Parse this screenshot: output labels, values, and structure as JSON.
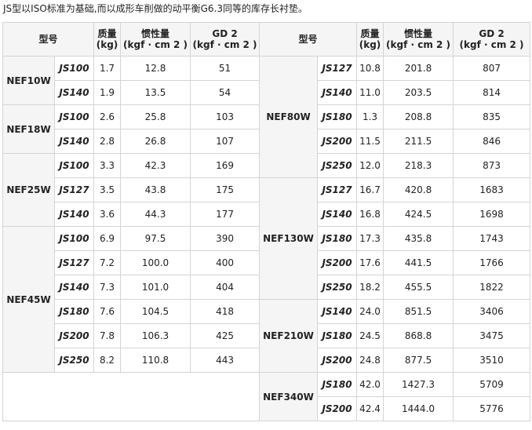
{
  "caption": "JS型以ISO标准为基础,而以成形车削做的动平衡G6.3同等的库存长衬垫。",
  "headers": {
    "model": "型号",
    "mass_l1": "质量",
    "mass_l2": "(kg)",
    "inertia_l1": "惯性量",
    "inertia_l2": "(kgf · cm 2 )",
    "gd2_l1": "GD 2",
    "gd2_l2": "(kgf · cm 2 )"
  },
  "left": [
    {
      "group": "NEF10W",
      "rows": [
        {
          "model": "JS100",
          "mass": "1.7",
          "inertia": "12.8",
          "gd2": "51"
        },
        {
          "model": "JS140",
          "mass": "1.9",
          "inertia": "13.5",
          "gd2": "54"
        }
      ]
    },
    {
      "group": "NEF18W",
      "rows": [
        {
          "model": "JS100",
          "mass": "2.6",
          "inertia": "25.8",
          "gd2": "103"
        },
        {
          "model": "JS140",
          "mass": "2.8",
          "inertia": "26.8",
          "gd2": "107"
        }
      ]
    },
    {
      "group": "NEF25W",
      "rows": [
        {
          "model": "JS100",
          "mass": "3.3",
          "inertia": "42.3",
          "gd2": "169"
        },
        {
          "model": "JS127",
          "mass": "3.5",
          "inertia": "43.8",
          "gd2": "175"
        },
        {
          "model": "JS140",
          "mass": "3.6",
          "inertia": "44.3",
          "gd2": "177"
        }
      ]
    },
    {
      "group": "NEF45W",
      "rows": [
        {
          "model": "JS100",
          "mass": "6.9",
          "inertia": "97.5",
          "gd2": "390"
        },
        {
          "model": "JS127",
          "mass": "7.2",
          "inertia": "100.0",
          "gd2": "400"
        },
        {
          "model": "JS140",
          "mass": "7.3",
          "inertia": "101.0",
          "gd2": "404"
        },
        {
          "model": "JS180",
          "mass": "7.6",
          "inertia": "104.5",
          "gd2": "418"
        },
        {
          "model": "JS200",
          "mass": "7.8",
          "inertia": "106.3",
          "gd2": "425"
        },
        {
          "model": "JS250",
          "mass": "8.2",
          "inertia": "110.8",
          "gd2": "443"
        }
      ]
    }
  ],
  "right": [
    {
      "group": "NEF80W",
      "rows": [
        {
          "model": "JS127",
          "mass": "10.8",
          "inertia": "201.8",
          "gd2": "807"
        },
        {
          "model": "JS140",
          "mass": "11.0",
          "inertia": "203.5",
          "gd2": "814"
        },
        {
          "model": "JS180",
          "mass": "1.3",
          "inertia": "208.8",
          "gd2": "835"
        },
        {
          "model": "JS200",
          "mass": "11.5",
          "inertia": "211.5",
          "gd2": "846"
        },
        {
          "model": "JS250",
          "mass": "12.0",
          "inertia": "218.3",
          "gd2": "873"
        }
      ]
    },
    {
      "group": "NEF130W",
      "rows": [
        {
          "model": "JS127",
          "mass": "16.7",
          "inertia": "420.8",
          "gd2": "1683"
        },
        {
          "model": "JS140",
          "mass": "16.8",
          "inertia": "424.5",
          "gd2": "1698"
        },
        {
          "model": "JS180",
          "mass": "17.3",
          "inertia": "435.8",
          "gd2": "1743"
        },
        {
          "model": "JS200",
          "mass": "17.6",
          "inertia": "441.5",
          "gd2": "1766"
        },
        {
          "model": "JS250",
          "mass": "18.2",
          "inertia": "455.5",
          "gd2": "1822"
        }
      ]
    },
    {
      "group": "NEF210W",
      "rows": [
        {
          "model": "JS140",
          "mass": "24.0",
          "inertia": "851.5",
          "gd2": "3406"
        },
        {
          "model": "JS180",
          "mass": "24.5",
          "inertia": "868.8",
          "gd2": "3475"
        },
        {
          "model": "JS200",
          "mass": "24.8",
          "inertia": "877.5",
          "gd2": "3510"
        }
      ]
    },
    {
      "group": "NEF340W",
      "rows": [
        {
          "model": "JS180",
          "mass": "42.0",
          "inertia": "1427.3",
          "gd2": "5709"
        },
        {
          "model": "JS200",
          "mass": "42.4",
          "inertia": "1444.0",
          "gd2": "5776"
        }
      ]
    }
  ]
}
